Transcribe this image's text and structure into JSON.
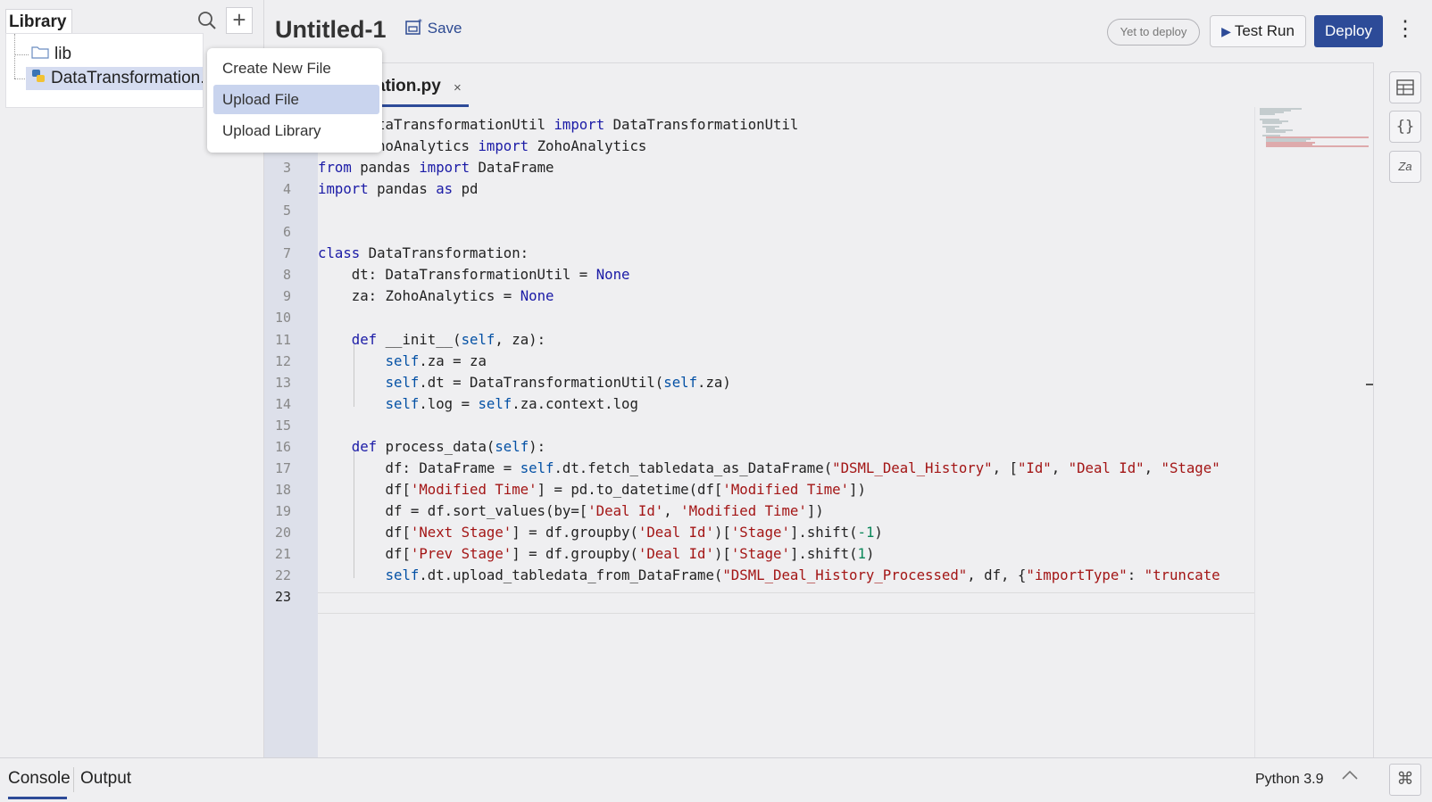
{
  "library": {
    "tab_label": "Library",
    "tree": [
      {
        "label": "lib",
        "icon": "folder-icon"
      },
      {
        "label": "DataTransformation.py",
        "icon": "python-file-icon"
      }
    ]
  },
  "menu": {
    "items": [
      "Create New File",
      "Upload File",
      "Upload Library"
    ],
    "active_index": 1
  },
  "header": {
    "title": "Untitled-1",
    "save_label": "Save",
    "deploy_status": "Yet to deploy",
    "test_run_label": "Test Run",
    "deploy_label": "Deploy"
  },
  "editor": {
    "active_tab": "DataTransformation.py",
    "visible_tab_text": "ation.py",
    "tab_close": "×",
    "current_line": 23,
    "lines": [
      "from DataTransformationUtil import DataTransformationUtil",
      "from ZohoAnalytics import ZohoAnalytics",
      "from pandas import DataFrame",
      "import pandas as pd",
      "",
      "",
      "class DataTransformation:",
      "    dt: DataTransformationUtil = None",
      "    za: ZohoAnalytics = None",
      "",
      "    def __init__(self, za):",
      "        self.za = za",
      "        self.dt = DataTransformationUtil(self.za)",
      "        self.log = self.za.context.log",
      "",
      "    def process_data(self):",
      "        df: DataFrame = self.dt.fetch_tabledata_as_DataFrame(\"DSML_Deal_History\", [\"Id\", \"Deal Id\", \"Stage\"",
      "        df['Modified Time'] = pd.to_datetime(df['Modified Time'])",
      "        df = df.sort_values(by=['Deal Id', 'Modified Time'])",
      "        df['Next Stage'] = df.groupby('Deal Id')['Stage'].shift(-1)",
      "        df['Prev Stage'] = df.groupby('Deal Id')['Stage'].shift(1)",
      "        self.dt.upload_tabledata_from_DataFrame(\"DSML_Deal_History_Processed\", df, {\"importType\": \"truncate",
      ""
    ]
  },
  "right_toolbar": [
    "table-icon",
    "braces-icon",
    "signature-icon"
  ],
  "bottom": {
    "console_tab": "Console",
    "output_tab": "Output",
    "python_version": "Python 3.9",
    "collapse_icon": "chevron-up-icon",
    "cmd_icon": "command-icon"
  },
  "colors": {
    "accent": "#2d4b98",
    "menu_highlight": "#c9d4ee",
    "keyword": "#1a1aa6",
    "string": "#a31515"
  }
}
